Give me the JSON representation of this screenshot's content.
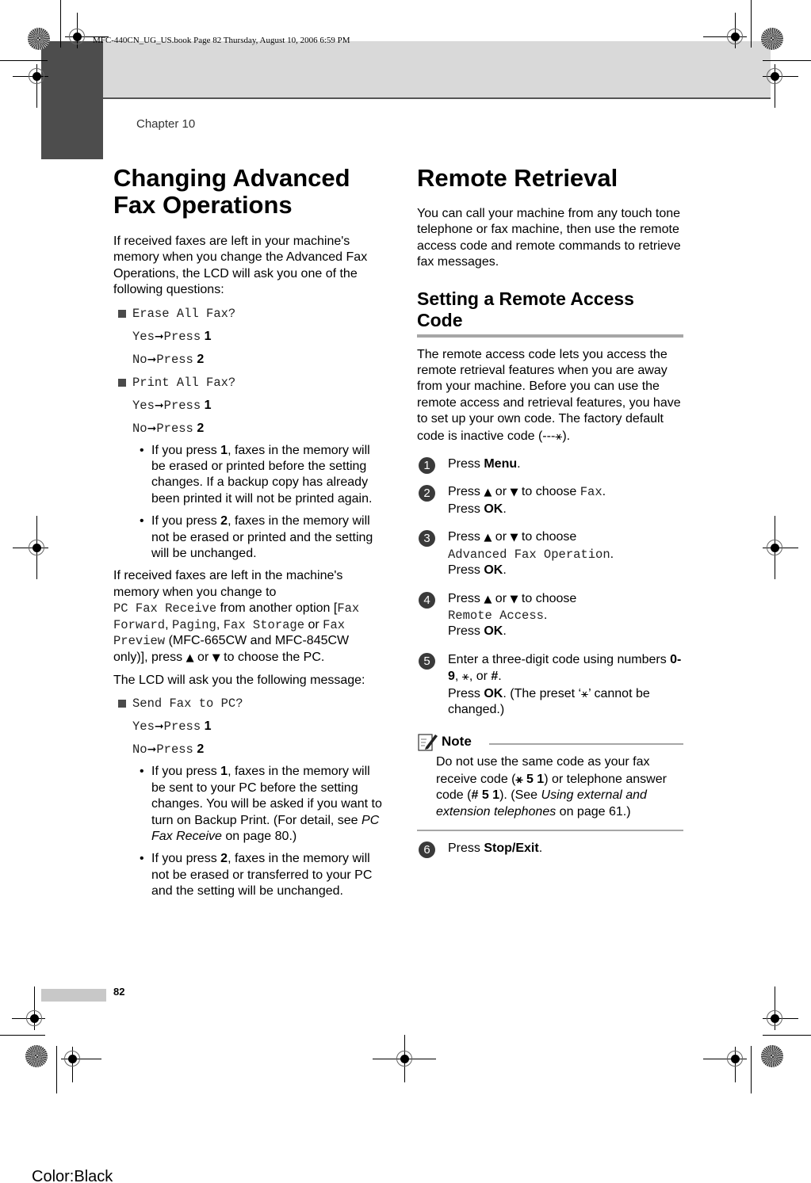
{
  "header": {
    "book_info": "MFC-440CN_UG_US.book  Page 82  Thursday, August 10, 2006  6:59 PM",
    "chapter": "Chapter 10"
  },
  "left": {
    "title": "Changing Advanced Fax Operations",
    "intro": "If received faxes are left in your machine's memory when you change the Advanced Fax Operations, the LCD will ask you one of the following questions:",
    "questions": [
      {
        "prompt": "Erase All Fax?",
        "yes": "Yes",
        "no": "No",
        "press": "Press",
        "key1": "1",
        "key2": "2"
      },
      {
        "prompt": "Print All Fax?",
        "yes": "Yes",
        "no": "No",
        "press": "Press",
        "key1": "1",
        "key2": "2"
      }
    ],
    "bullets1": [
      {
        "pre": "If you press ",
        "key": "1",
        "post": ", faxes in the memory will be erased or printed before the setting changes. If a backup copy has already been printed it will not be printed again."
      },
      {
        "pre": "If you press ",
        "key": "2",
        "post": ", faxes in the memory will not be erased or printed and the setting will be unchanged."
      }
    ],
    "para2": {
      "t1": "If received faxes are left in the machine's memory when you change to",
      "m1": "PC Fax Receive",
      "t2": " from another option [",
      "m2": "Fax Forward",
      "t3": ", ",
      "m3": "Paging",
      "t4": ", ",
      "m4": "Fax Storage",
      "t5": " or ",
      "m5": "Fax Preview",
      "t6": " (MFC-665CW and MFC-845CW only)], press ",
      "up": "▲",
      "or": " or ",
      "down": "▼",
      "t7": " to choose the PC."
    },
    "para3": "The LCD will ask you the following message:",
    "question3": {
      "prompt": "Send Fax to PC?",
      "yes": "Yes",
      "no": "No",
      "press": "Press",
      "key1": "1",
      "key2": "2"
    },
    "bullets2": [
      {
        "pre": "If you press ",
        "key": "1",
        "post": ", faxes in the memory will be sent to your PC before the setting changes. You will be asked if you want to turn on Backup Print. (For detail, see ",
        "ital": "PC Fax Receive",
        "post2": " on page 80.)"
      },
      {
        "pre": "If you press ",
        "key": "2",
        "post": ", faxes in the memory will not be erased or transferred to your PC and the setting will be unchanged."
      }
    ]
  },
  "right": {
    "title": "Remote Retrieval",
    "intro": "You can call your machine from any touch tone telephone or fax machine, then use the remote access code and remote commands to retrieve fax messages.",
    "subtitle": "Setting a Remote Access Code",
    "sub_intro": "The remote access code lets you access the remote retrieval features when you are away from your machine. Before you can use the remote access and retrieval features, you have to set up your own code. The factory default code is inactive code (---",
    "sub_intro_end": ").",
    "star": "⚹",
    "steps": [
      {
        "num": "1",
        "pre": "Press ",
        "bold": "Menu",
        "post": "."
      },
      {
        "num": "2",
        "pre": "Press ",
        "choose": " to choose ",
        "mono": "Fax",
        "ok_pre": "Press ",
        "ok": "OK"
      },
      {
        "num": "3",
        "pre": "Press ",
        "choose": " to choose",
        "mono": "Advanced Fax Operation",
        "ok_pre": "Press ",
        "ok": "OK"
      },
      {
        "num": "4",
        "pre": "Press ",
        "choose": " to choose",
        "mono": "Remote Access",
        "ok_pre": "Press ",
        "ok": "OK"
      },
      {
        "num": "5",
        "text": "Enter a three-digit code using numbers ",
        "digits": "0-9",
        "or_hash": ", or ",
        "hash": "#",
        "ok_pre": "Press ",
        "ok": "OK",
        "tail1": ". (The preset ‘",
        "tail2": "’ cannot be changed.)"
      },
      {
        "num": "6",
        "pre": "Press ",
        "bold": "Stop/Exit",
        "post": "."
      }
    ],
    "note": {
      "label": "Note",
      "t1": "Do not use the same code as your fax receive code (",
      "code1": " 5 1",
      "t2": ") or telephone answer code (",
      "code2": "# 5 1",
      "t3": "). (See ",
      "ital": "Using external and extension telephones",
      "t4": " on page 61.)"
    }
  },
  "footer": {
    "page_number": "82",
    "color_label": "Color:Black"
  }
}
